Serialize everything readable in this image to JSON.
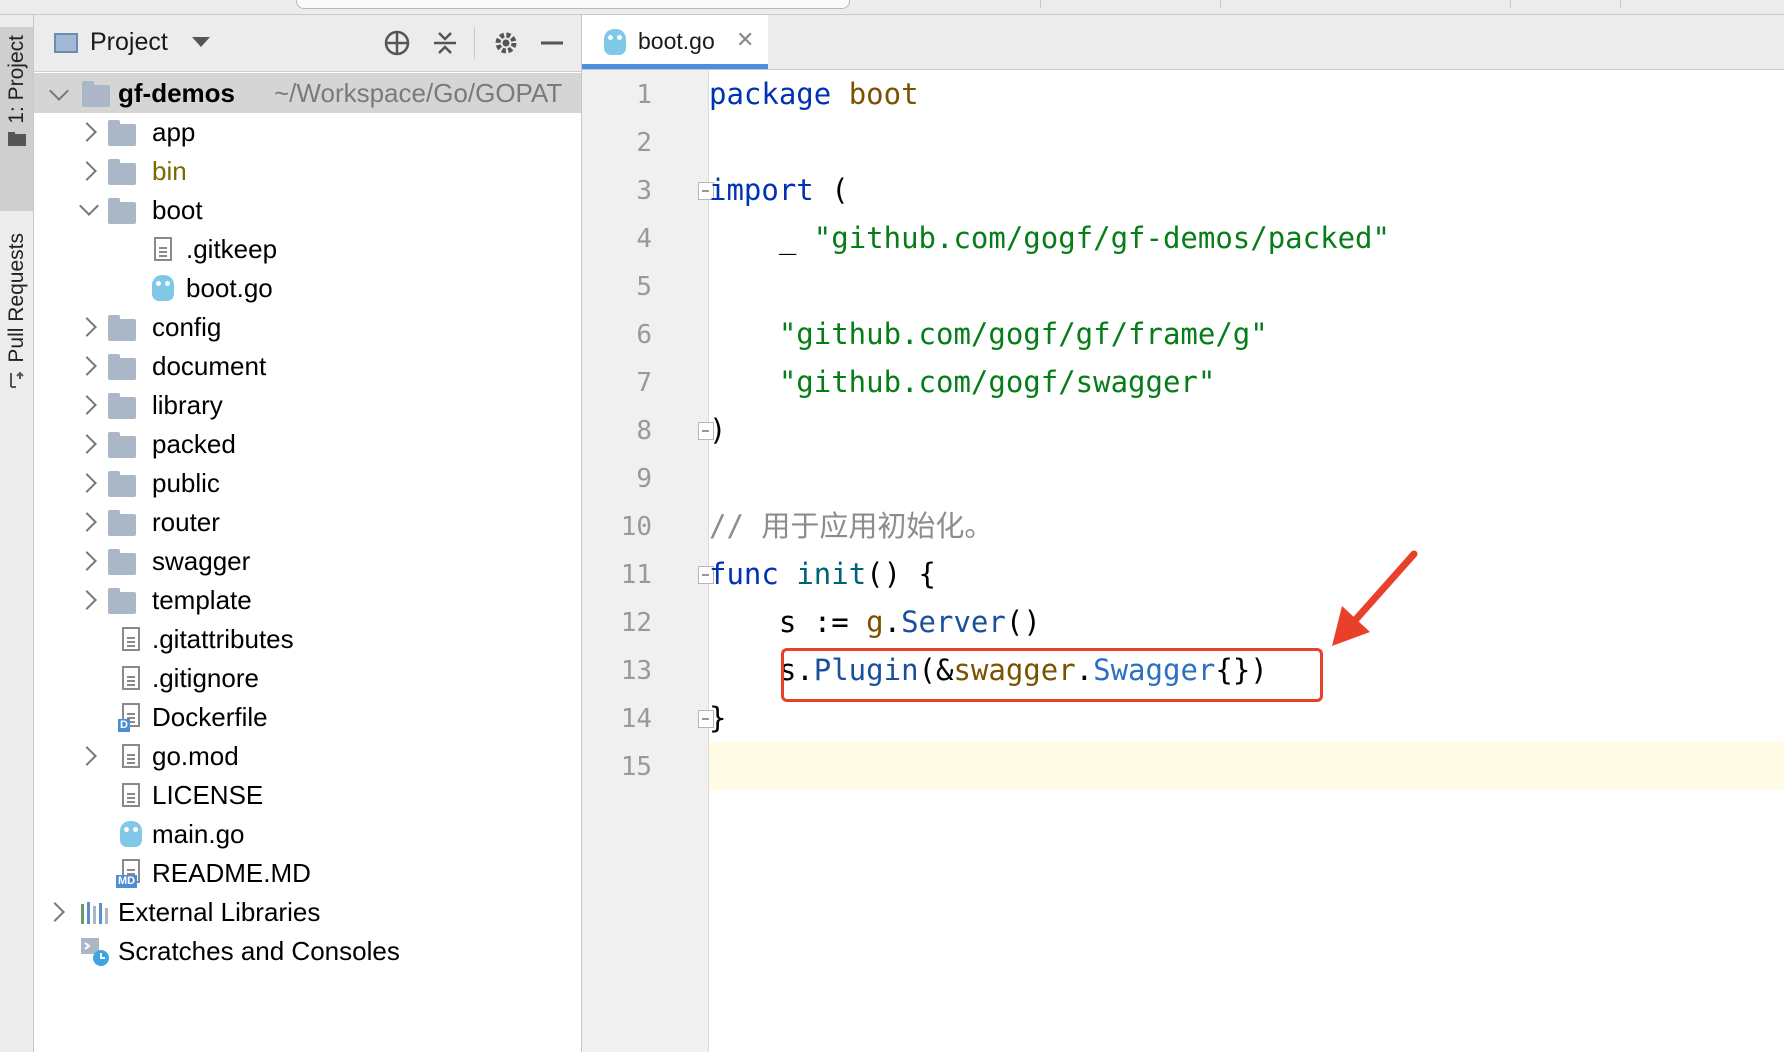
{
  "project_panel": {
    "title": "Project",
    "icons": [
      "locate-icon",
      "collapse-all-icon",
      "gear-icon",
      "minimize-icon"
    ],
    "root": {
      "name": "gf-demos",
      "path": "~/Workspace/Go/GOPAT"
    },
    "items": [
      {
        "label": "app",
        "type": "folder"
      },
      {
        "label": "bin",
        "type": "folder"
      },
      {
        "label": "boot",
        "type": "folder"
      },
      {
        "label": ".gitkeep",
        "type": "file"
      },
      {
        "label": "boot.go",
        "type": "go"
      },
      {
        "label": "config",
        "type": "folder"
      },
      {
        "label": "document",
        "type": "folder"
      },
      {
        "label": "library",
        "type": "folder"
      },
      {
        "label": "packed",
        "type": "folder"
      },
      {
        "label": "public",
        "type": "folder"
      },
      {
        "label": "router",
        "type": "folder"
      },
      {
        "label": "swagger",
        "type": "folder"
      },
      {
        "label": "template",
        "type": "folder"
      },
      {
        "label": ".gitattributes",
        "type": "file"
      },
      {
        "label": ".gitignore",
        "type": "file"
      },
      {
        "label": "Dockerfile",
        "type": "docker",
        "badge": "D"
      },
      {
        "label": "go.mod",
        "type": "file"
      },
      {
        "label": "LICENSE",
        "type": "file"
      },
      {
        "label": "main.go",
        "type": "go"
      },
      {
        "label": "README.MD",
        "type": "md",
        "badge": "MD"
      },
      {
        "label": "External Libraries",
        "type": "libraries"
      },
      {
        "label": "Scratches and Consoles",
        "type": "scratches"
      }
    ]
  },
  "tool_strip": {
    "tabs": [
      {
        "label": "1: Project",
        "icon": "folder-icon"
      },
      {
        "label": "Pull Requests",
        "icon": "pull-request-icon"
      }
    ]
  },
  "editor": {
    "tab": {
      "name": "boot.go"
    },
    "line_numbers": [
      "1",
      "2",
      "3",
      "4",
      "5",
      "6",
      "7",
      "8",
      "9",
      "10",
      "11",
      "12",
      "13",
      "14",
      "15"
    ],
    "lines": {
      "l1": {
        "kw": "package",
        "name": "boot"
      },
      "l3": {
        "kw": "import",
        "paren": "("
      },
      "l4": {
        "underscore": "_",
        "str": "\"github.com/gogf/gf-demos/packed\""
      },
      "l6": {
        "str": "\"github.com/gogf/gf/frame/g\""
      },
      "l7": {
        "str": "\"github.com/gogf/swagger\""
      },
      "l8": {
        "paren": ")"
      },
      "l10": {
        "comment": "// 用于应用初始化。"
      },
      "l11": {
        "kw": "func",
        "fn": "init",
        "rest": "() {"
      },
      "l12": {
        "var": "s := ",
        "pkg": "g",
        "dot": ".",
        "method": "Server",
        "rest": "()"
      },
      "l13": {
        "var": "s.",
        "method": "Plugin",
        "amp": "(&",
        "pkg": "swagger",
        "dot": ".",
        "type": "Swagger",
        "rest": "{})"
      },
      "l14": {
        "brace": "}"
      }
    }
  },
  "annotation_color": "#e8402a"
}
